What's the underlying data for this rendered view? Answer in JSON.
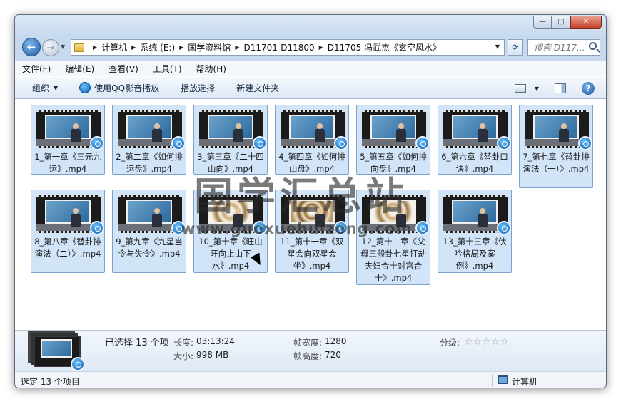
{
  "window": {
    "controls": [
      "—",
      "□",
      "✕"
    ]
  },
  "address": {
    "crumbs": [
      "计算机",
      "系统 (E:)",
      "国学资料馆",
      "D11701-D11800",
      "D11705 冯武杰《玄空风水》"
    ],
    "search_placeholder": "搜索 D117..."
  },
  "menu": {
    "items": [
      "文件(F)",
      "编辑(E)",
      "查看(V)",
      "工具(T)",
      "帮助(H)"
    ]
  },
  "toolbar": {
    "organize": "组织",
    "play_qq": "使用QQ影音播放",
    "play_selection": "播放选择",
    "new_folder": "新建文件夹"
  },
  "files": [
    {
      "name": "1_第一章《三元九运》.mp4"
    },
    {
      "name": "2_第二章《如何排运盘》.mp4"
    },
    {
      "name": "3_第三章《二十四山向》.mp4"
    },
    {
      "name": "4_第四章《如何排山盘》.mp4"
    },
    {
      "name": "5_第五章《如何排向盘》.mp4"
    },
    {
      "name": "6_第六章《替卦口诀》.mp4"
    },
    {
      "name": "7_第七章《替卦排演法（一）》.mp4"
    },
    {
      "name": "8_第八章《替卦排演法（二）》.mp4"
    },
    {
      "name": "9_第九章《九星当令与失令》.mp4"
    },
    {
      "name": "10_第十章《旺山旺向上山下水》.mp4"
    },
    {
      "name": "11_第十一章《双星会向双星会坐》.mp4"
    },
    {
      "name": "12_第十二章《父母三般卦七星打劫夫妇合十对宫合十》.mp4"
    },
    {
      "name": "13_第十三章《伏吟格局及案例》.mp4"
    }
  ],
  "watermark": {
    "title": "国学汇总站",
    "url": "www.guoxuehuizong.com"
  },
  "details": {
    "selected": "已选择 13 个项",
    "length_label": "长度:",
    "length_value": "03:13:24",
    "size_label": "大小:",
    "size_value": "998 MB",
    "frame_width_label": "帧宽度:",
    "frame_width_value": "1280",
    "frame_height_label": "帧高度:",
    "frame_height_value": "720",
    "rating_label": "分级:",
    "rating_stars": "☆☆☆☆☆"
  },
  "status": {
    "left": "选定 13 个项目",
    "right": "计算机"
  }
}
